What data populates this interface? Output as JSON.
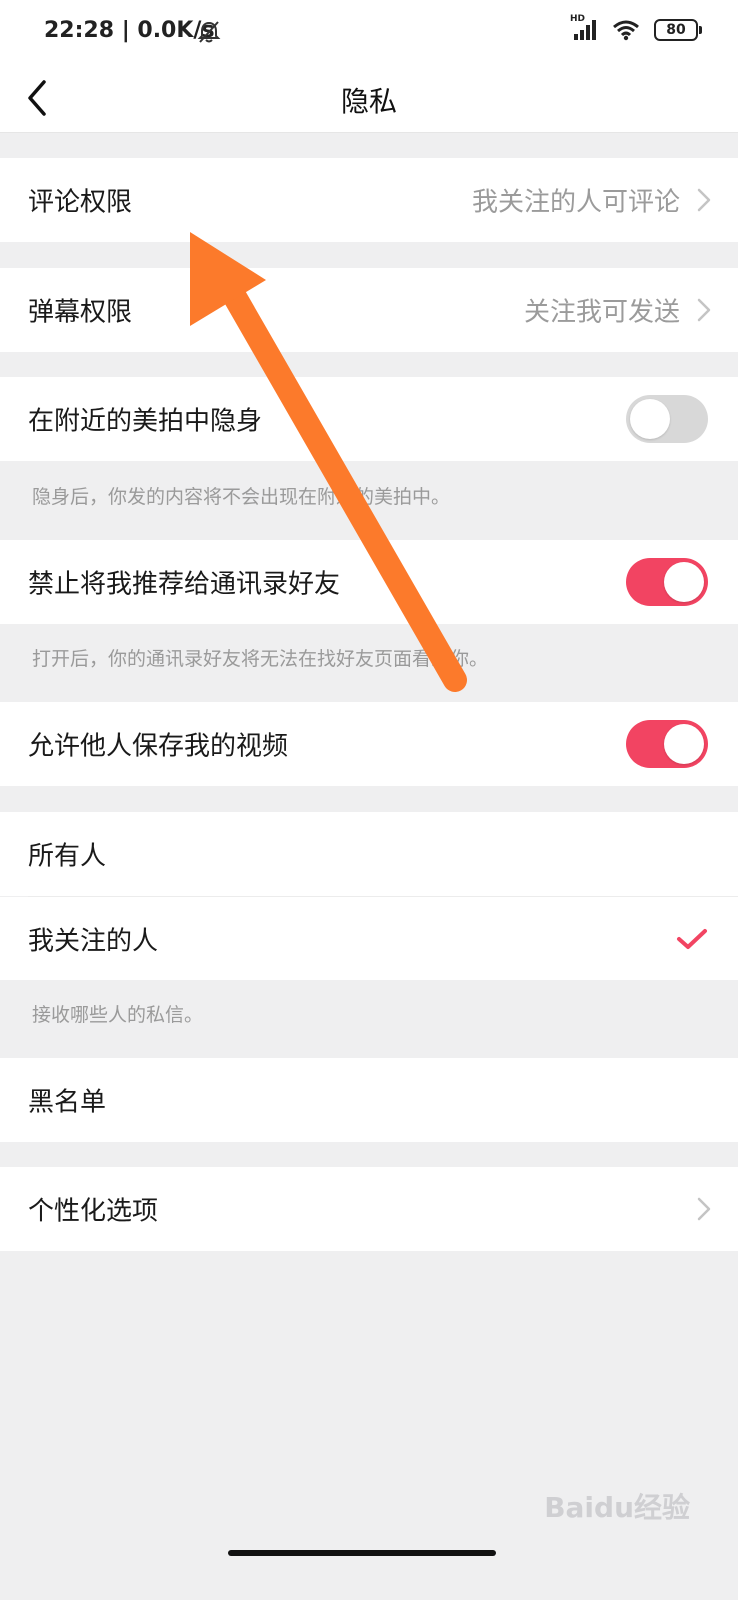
{
  "status_bar": {
    "time": "22:28 | 0.0K/s",
    "network_label": "HD",
    "battery": "80"
  },
  "header": {
    "title": "隐私"
  },
  "rows": {
    "comment_permission": {
      "label": "评论权限",
      "value": "我关注的人可评论"
    },
    "danmaku_permission": {
      "label": "弹幕权限",
      "value": "关注我可发送"
    },
    "nearby_invisible": {
      "label": "在附近的美拍中隐身",
      "enabled": false,
      "hint": "隐身后，你发的内容将不会出现在附近的美拍中。"
    },
    "no_contact_recommend": {
      "label": "禁止将我推荐给通讯录好友",
      "enabled": true,
      "hint": "打开后，你的通讯录好友将无法在找好友页面看到你。"
    },
    "allow_save_video": {
      "label": "允许他人保存我的视频",
      "enabled": true
    }
  },
  "messages": {
    "options": [
      {
        "label": "所有人",
        "selected": false
      },
      {
        "label": "我关注的人",
        "selected": true
      }
    ],
    "hint": "接收哪些人的私信。"
  },
  "blacklist": {
    "label": "黑名单"
  },
  "personalization": {
    "label": "个性化选项"
  },
  "watermark": "Baidu经验",
  "colors": {
    "accent": "#f24462",
    "annotation_arrow": "#fc7a2b"
  }
}
